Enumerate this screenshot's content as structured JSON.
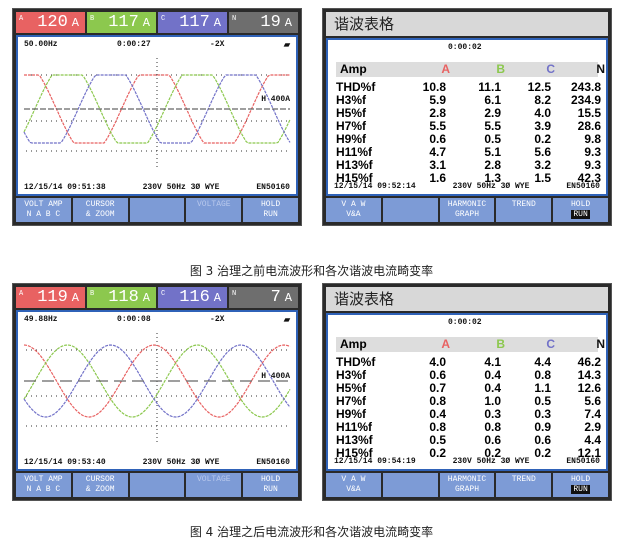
{
  "figures": [
    {
      "caption": "图 3 治理之前电流波形和各次谐波电流畸变率",
      "scope": {
        "readings": [
          {
            "phase": "A",
            "value": "120",
            "unit": "A"
          },
          {
            "phase": "B",
            "value": "117",
            "unit": "A"
          },
          {
            "phase": "C",
            "value": "117",
            "unit": "A"
          },
          {
            "phase": "N",
            "value": "19",
            "unit": "A"
          }
        ],
        "status_top": [
          "50.00Hz",
          "0:00:27",
          "-2X"
        ],
        "scale_label": "H 400A",
        "status_bottom": [
          "12/15/14 09:51:38",
          "230V 50Hz 3Ø WYE",
          "EN50160"
        ],
        "buttons": [
          {
            "l1": "VOLT AMP",
            "l2": "N A B C"
          },
          {
            "l1": "CURSOR",
            "l2": "& ZOOM"
          },
          {
            "l1": "",
            "l2": ""
          },
          {
            "l1": "VOLTAGE",
            "l2": ""
          },
          {
            "l1": "HOLD",
            "l2": "RUN"
          }
        ]
      },
      "harmonics": {
        "title": "谐波表格",
        "status_top": "0:00:02",
        "headers": [
          "Amp",
          "A",
          "B",
          "C",
          "N"
        ],
        "rows": [
          [
            "THD%f",
            "10.8",
            "11.1",
            "12.5",
            "243.8"
          ],
          [
            "H3%f",
            "5.9",
            "6.1",
            "8.2",
            "234.9"
          ],
          [
            "H5%f",
            "2.8",
            "2.9",
            "4.0",
            "15.5"
          ],
          [
            "H7%f",
            "5.5",
            "5.5",
            "3.9",
            "28.6"
          ],
          [
            "H9%f",
            "0.6",
            "0.5",
            "0.2",
            "9.8"
          ],
          [
            "H11%f",
            "4.7",
            "5.1",
            "5.6",
            "9.3"
          ],
          [
            "H13%f",
            "3.1",
            "2.8",
            "3.2",
            "9.3"
          ],
          [
            "H15%f",
            "1.6",
            "1.3",
            "1.5",
            "42.3"
          ]
        ],
        "status_bottom": [
          "12/15/14 09:52:14",
          "230V 50Hz 3Ø WYE",
          "EN50160"
        ],
        "buttons": [
          {
            "l1": "V A W",
            "l2": "V&A"
          },
          {
            "l1": "",
            "l2": ""
          },
          {
            "l1": "HARMONIC",
            "l2": "GRAPH"
          },
          {
            "l1": "TREND",
            "l2": ""
          },
          {
            "l1": "HOLD",
            "l2": "RUN"
          }
        ]
      }
    },
    {
      "caption": "图 4 治理之后电流波形和各次谐波电流畸变率",
      "scope": {
        "readings": [
          {
            "phase": "A",
            "value": "119",
            "unit": "A"
          },
          {
            "phase": "B",
            "value": "118",
            "unit": "A"
          },
          {
            "phase": "C",
            "value": "116",
            "unit": "A"
          },
          {
            "phase": "N",
            "value": "7",
            "unit": "A"
          }
        ],
        "status_top": [
          "49.88Hz",
          "0:00:08",
          "-2X"
        ],
        "scale_label": "H 400A",
        "status_bottom": [
          "12/15/14 09:53:40",
          "230V 50Hz 3Ø WYE",
          "EN50160"
        ],
        "buttons": [
          {
            "l1": "VOLT AMP",
            "l2": "N A B C"
          },
          {
            "l1": "CURSOR",
            "l2": "& ZOOM"
          },
          {
            "l1": "",
            "l2": ""
          },
          {
            "l1": "VOLTAGE",
            "l2": ""
          },
          {
            "l1": "HOLD",
            "l2": "RUN"
          }
        ]
      },
      "harmonics": {
        "title": "谐波表格",
        "status_top": "0:00:02",
        "headers": [
          "Amp",
          "A",
          "B",
          "C",
          "N"
        ],
        "rows": [
          [
            "THD%f",
            "4.0",
            "4.1",
            "4.4",
            "46.2"
          ],
          [
            "H3%f",
            "0.6",
            "0.4",
            "0.8",
            "14.3"
          ],
          [
            "H5%f",
            "0.7",
            "0.4",
            "1.1",
            "12.6"
          ],
          [
            "H7%f",
            "0.8",
            "1.0",
            "0.5",
            "5.6"
          ],
          [
            "H9%f",
            "0.4",
            "0.3",
            "0.3",
            "7.4"
          ],
          [
            "H11%f",
            "0.8",
            "0.8",
            "0.9",
            "2.9"
          ],
          [
            "H13%f",
            "0.5",
            "0.6",
            "0.6",
            "4.4"
          ],
          [
            "H15%f",
            "0.2",
            "0.2",
            "0.2",
            "12.1"
          ]
        ],
        "status_bottom": [
          "12/15/14 09:54:19",
          "230V 50Hz 3Ø WYE",
          "EN50160"
        ],
        "buttons": [
          {
            "l1": "V A W",
            "l2": "V&A"
          },
          {
            "l1": "",
            "l2": ""
          },
          {
            "l1": "HARMONIC",
            "l2": "GRAPH"
          },
          {
            "l1": "TREND",
            "l2": ""
          },
          {
            "l1": "HOLD",
            "l2": "RUN"
          }
        ]
      }
    }
  ],
  "colors": {
    "A": "#e86262",
    "B": "#8cc84e",
    "C": "#7272c8",
    "N": "#6e6e6e",
    "frame": "#2f62b8",
    "button": "#7d9bd6"
  }
}
